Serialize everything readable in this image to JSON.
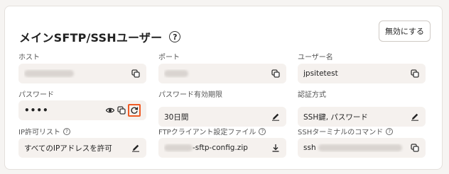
{
  "header": {
    "title": "メインSFTP/SSHユーザー",
    "disable_label": "無効にする"
  },
  "fields": {
    "host": {
      "label": "ホスト"
    },
    "port": {
      "label": "ポート"
    },
    "username": {
      "label": "ユーザー名",
      "value": "jpsitetest"
    },
    "password": {
      "label": "パスワード",
      "value": "••••"
    },
    "password_expiry": {
      "label": "パスワード有効期限",
      "value": "30日間"
    },
    "auth_method": {
      "label": "認証方式",
      "value": "SSH鍵, パスワード"
    },
    "ip_allowlist": {
      "label": "IP許可リスト",
      "value": "すべてのIPアドレスを許可"
    },
    "ftp_config": {
      "label": "FTPクライアント設定ファイル",
      "value_suffix": "-sftp-config.zip"
    },
    "ssh_command": {
      "label": "SSHターミナルのコマンド",
      "value_prefix": "ssh"
    }
  },
  "icons": {
    "help": "help-circle-icon",
    "copy": "copy-icon",
    "edit": "pencil-icon",
    "download": "download-icon",
    "show": "eye-icon",
    "regenerate": "refresh-icon"
  },
  "colors": {
    "highlight": "#ef5a24",
    "field_bg": "#f5f1ee"
  }
}
